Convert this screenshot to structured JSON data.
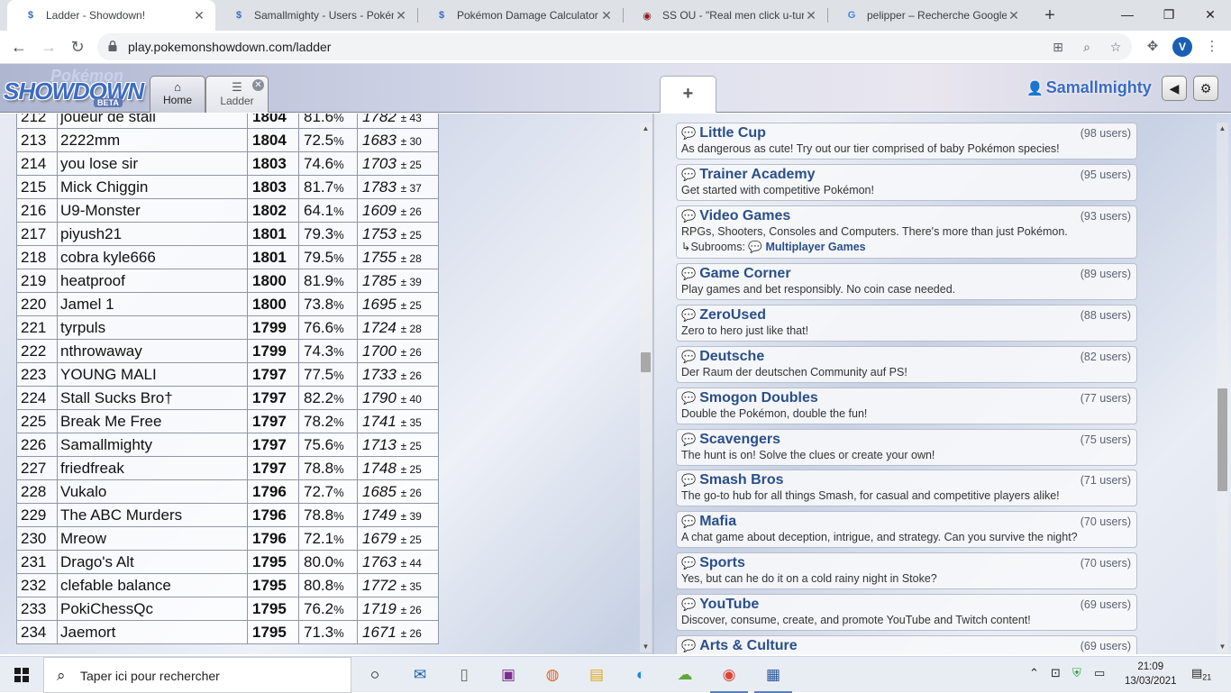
{
  "browser": {
    "tabs": [
      {
        "title": "Ladder - Showdown!",
        "favicon": "S"
      },
      {
        "title": "Samallmighty - Users - Pokém",
        "favicon": "S"
      },
      {
        "title": "Pokémon Damage Calculator",
        "favicon": "S"
      },
      {
        "title": "SS OU - \"Real men click u-turn",
        "favicon": "◉"
      },
      {
        "title": "pelipper – Recherche Google",
        "favicon": "G"
      }
    ],
    "url": "play.pokemonshowdown.com/ladder",
    "profile_initial": "V"
  },
  "showdown": {
    "logo_top": "Pokémon",
    "logo_main": "SHOWDOWN",
    "logo_beta": "BETA",
    "tab_home": "Home",
    "tab_ladder": "Ladder",
    "username": "Samallmighty"
  },
  "ladder": {
    "rows": [
      {
        "rank": "212",
        "name": "joueur de stall",
        "elo": "1804",
        "gxe": "81.6",
        "glicko": "1782",
        "dev": "43"
      },
      {
        "rank": "213",
        "name": "2222mm",
        "elo": "1804",
        "gxe": "72.5",
        "glicko": "1683",
        "dev": "30"
      },
      {
        "rank": "214",
        "name": "you lose sir",
        "elo": "1803",
        "gxe": "74.6",
        "glicko": "1703",
        "dev": "25"
      },
      {
        "rank": "215",
        "name": "Mick Chiggin",
        "elo": "1803",
        "gxe": "81.7",
        "glicko": "1783",
        "dev": "37"
      },
      {
        "rank": "216",
        "name": "U9-Monster",
        "elo": "1802",
        "gxe": "64.1",
        "glicko": "1609",
        "dev": "26"
      },
      {
        "rank": "217",
        "name": "piyush21",
        "elo": "1801",
        "gxe": "79.3",
        "glicko": "1753",
        "dev": "25"
      },
      {
        "rank": "218",
        "name": "cobra kyle666",
        "elo": "1801",
        "gxe": "79.5",
        "glicko": "1755",
        "dev": "28"
      },
      {
        "rank": "219",
        "name": "heatproof",
        "elo": "1800",
        "gxe": "81.9",
        "glicko": "1785",
        "dev": "39"
      },
      {
        "rank": "220",
        "name": "Jamel 1",
        "elo": "1800",
        "gxe": "73.8",
        "glicko": "1695",
        "dev": "25"
      },
      {
        "rank": "221",
        "name": "tyrpuls",
        "elo": "1799",
        "gxe": "76.6",
        "glicko": "1724",
        "dev": "28"
      },
      {
        "rank": "222",
        "name": "nthrowaway",
        "elo": "1799",
        "gxe": "74.3",
        "glicko": "1700",
        "dev": "26"
      },
      {
        "rank": "223",
        "name": "YOUNG MALI",
        "elo": "1797",
        "gxe": "77.5",
        "glicko": "1733",
        "dev": "26"
      },
      {
        "rank": "224",
        "name": "Stall Sucks Bro†",
        "elo": "1797",
        "gxe": "82.2",
        "glicko": "1790",
        "dev": "40"
      },
      {
        "rank": "225",
        "name": "Break Me Free",
        "elo": "1797",
        "gxe": "78.2",
        "glicko": "1741",
        "dev": "35"
      },
      {
        "rank": "226",
        "name": "Samallmighty",
        "elo": "1797",
        "gxe": "75.6",
        "glicko": "1713",
        "dev": "25"
      },
      {
        "rank": "227",
        "name": "friedfreak",
        "elo": "1797",
        "gxe": "78.8",
        "glicko": "1748",
        "dev": "25"
      },
      {
        "rank": "228",
        "name": "Vukalo",
        "elo": "1796",
        "gxe": "72.7",
        "glicko": "1685",
        "dev": "26"
      },
      {
        "rank": "229",
        "name": "The ABC Murders",
        "elo": "1796",
        "gxe": "78.8",
        "glicko": "1749",
        "dev": "39"
      },
      {
        "rank": "230",
        "name": "Mreow",
        "elo": "1796",
        "gxe": "72.1",
        "glicko": "1679",
        "dev": "25"
      },
      {
        "rank": "231",
        "name": "Drago's Alt",
        "elo": "1795",
        "gxe": "80.0",
        "glicko": "1763",
        "dev": "44"
      },
      {
        "rank": "232",
        "name": "clefable balance",
        "elo": "1795",
        "gxe": "80.8",
        "glicko": "1772",
        "dev": "35"
      },
      {
        "rank": "233",
        "name": "PokiChessQc",
        "elo": "1795",
        "gxe": "76.2",
        "glicko": "1719",
        "dev": "26"
      },
      {
        "rank": "234",
        "name": "Jaemort",
        "elo": "1795",
        "gxe": "71.3",
        "glicko": "1671",
        "dev": "26"
      }
    ]
  },
  "rooms": [
    {
      "name": "Little Cup",
      "users": "(98 users)",
      "desc": "As dangerous as cute! Try out our tier comprised of baby Pokémon species!"
    },
    {
      "name": "Trainer Academy",
      "users": "(95 users)",
      "desc": "Get started with competitive Pokémon!"
    },
    {
      "name": "Video Games",
      "users": "(93 users)",
      "desc": "RPGs, Shooters, Consoles and Computers. There's more than just Pokémon.",
      "subrooms_label": "↳Subrooms:",
      "subroom": "Multiplayer Games"
    },
    {
      "name": "Game Corner",
      "users": "(89 users)",
      "desc": "Play games and bet responsibly. No coin case needed."
    },
    {
      "name": "ZeroUsed",
      "users": "(88 users)",
      "desc": "Zero to hero just like that!"
    },
    {
      "name": "Deutsche",
      "users": "(82 users)",
      "desc": "Der Raum der deutschen Community auf PS!"
    },
    {
      "name": "Smogon Doubles",
      "users": "(77 users)",
      "desc": "Double the Pokémon, double the fun!"
    },
    {
      "name": "Scavengers",
      "users": "(75 users)",
      "desc": "The hunt is on! Solve the clues or create your own!"
    },
    {
      "name": "Smash Bros",
      "users": "(71 users)",
      "desc": "The go-to hub for all things Smash, for casual and competitive players alike!"
    },
    {
      "name": "Mafia",
      "users": "(70 users)",
      "desc": "A chat game about deception, intrigue, and strategy. Can you survive the night?"
    },
    {
      "name": "Sports",
      "users": "(70 users)",
      "desc": "Yes, but can he do it on a cold rainy night in Stoke?"
    },
    {
      "name": "YouTube",
      "users": "(69 users)",
      "desc": "Discover, consume, create, and promote YouTube and Twitch content!"
    },
    {
      "name": "Arts & Culture",
      "users": "(69 users)",
      "desc": ""
    }
  ],
  "taskbar": {
    "search_placeholder": "Taper ici pour rechercher",
    "time": "21:09",
    "date": "13/03/2021",
    "notif_count": "21"
  }
}
